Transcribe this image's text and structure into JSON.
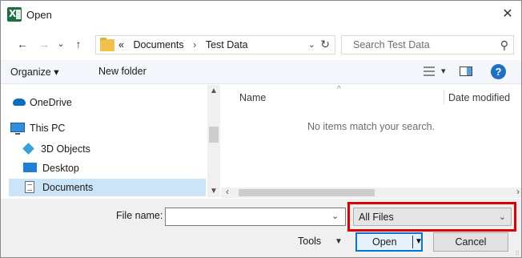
{
  "window": {
    "title": "Open",
    "close_glyph": "✕",
    "app_icon": "excel-icon"
  },
  "nav": {
    "back_glyph": "←",
    "forward_glyph": "→",
    "recent_glyph": "⌄",
    "up_glyph": "↑",
    "address": {
      "overflow": "«",
      "crumbs": [
        "Documents",
        "Test Data"
      ],
      "separator": "›",
      "dropdown_glyph": "⌄",
      "refresh_glyph": "↻"
    },
    "search": {
      "placeholder": "Search Test Data",
      "icon_glyph": "⚲"
    }
  },
  "toolbar": {
    "organize": "Organize ▾",
    "new_folder": "New folder",
    "view_drop": "▾",
    "help": "?"
  },
  "sidebar": {
    "items": [
      {
        "label": "OneDrive",
        "icon": "onedrive-icon"
      },
      {
        "label": "This PC",
        "icon": "computer-icon"
      },
      {
        "label": "3D Objects",
        "icon": "3d-objects-icon"
      },
      {
        "label": "Desktop",
        "icon": "desktop-icon"
      },
      {
        "label": "Documents",
        "icon": "documents-icon",
        "selected": true
      }
    ]
  },
  "scroll": {
    "up": "▲",
    "down": "▼",
    "left": "‹",
    "right": "›"
  },
  "content": {
    "sort_glyph": "^",
    "columns": [
      "Name",
      "Date modified"
    ],
    "empty_message": "No items match your search."
  },
  "bottom": {
    "file_name_label": "File name:",
    "file_name_value": "",
    "file_name_drop": "⌄",
    "file_type_value": "All Files",
    "file_type_drop": "⌄",
    "tools_label": "Tools",
    "tools_drop": "▼",
    "open_label": "Open",
    "open_drop": "▼",
    "cancel_label": "Cancel"
  },
  "colors": {
    "highlight": "#e00000",
    "accent": "#0078d7",
    "selection": "#cce4f7",
    "excel": "#1d6f42"
  }
}
